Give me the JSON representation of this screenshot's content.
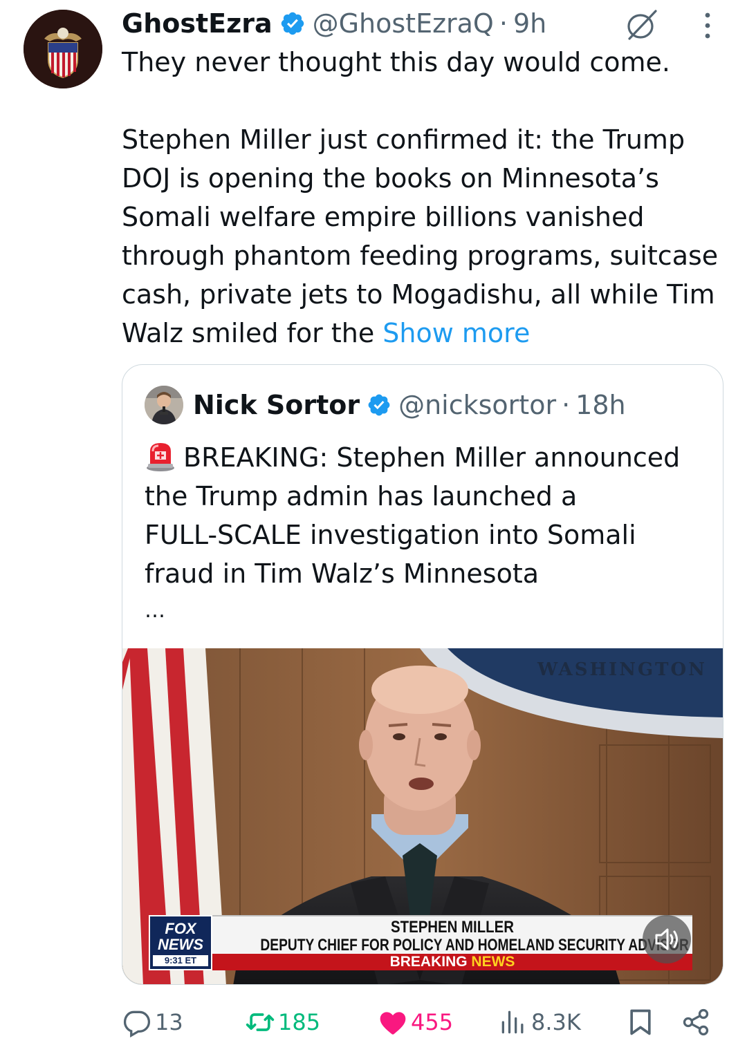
{
  "tweet": {
    "author_name": "GhostEzra",
    "author_handle": "@GhostEzraQ",
    "separator": "·",
    "time": "9h",
    "lines": [
      "They never thought this day would come.",
      "",
      "Stephen Miller just confirmed it: the Trump",
      "DOJ is opening the books on Minnesota’s",
      "Somali welfare empire billions vanished",
      "through phantom feeding programs, suitcase",
      "cash, private jets to Mogadishu, all while Tim"
    ],
    "last_line": "Walz smiled for the ",
    "show_more": "Show more"
  },
  "quote": {
    "author_name": "Nick Sortor",
    "author_handle": "@nicksortor",
    "separator": "·",
    "time": "18h",
    "lines": [
      "BREAKING: Stephen Miller announced",
      "the Trump admin has launched a",
      "FULL-SCALE investigation into Somali",
      "fraud in Tim Walz’s Minnesota"
    ],
    "ellipsis": "…",
    "media": {
      "backdrop_text": "WASHINGTON",
      "network_top": "FOX",
      "network_bottom": "NEWS",
      "network_time": "9:31 ET",
      "chyron_name": "STEPHEN MILLER",
      "chyron_title": "DEPUTY CHIEF FOR POLICY AND HOMELAND SECURITY ADVISOR",
      "breaking_word": "BREAKING",
      "news_word": "NEWS"
    }
  },
  "actions": {
    "replies": "13",
    "reposts": "185",
    "likes": "455",
    "views": "8.3K"
  },
  "colors": {
    "link": "#1d9bf0",
    "repost": "#00ba7c",
    "like": "#f91880",
    "secondary_text": "#536471",
    "verified": "#1d9bf0"
  },
  "icons": [
    "verified-badge-icon",
    "grok-icon",
    "more-options-icon",
    "siren-emoji-icon",
    "mute-icon",
    "reply-icon",
    "repost-icon",
    "like-icon",
    "views-icon",
    "bookmark-icon",
    "share-icon"
  ]
}
